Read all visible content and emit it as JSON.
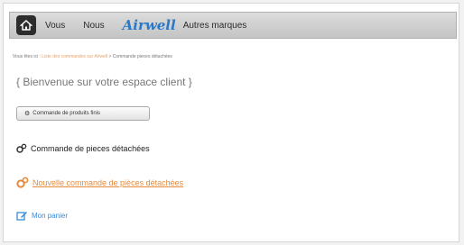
{
  "nav": {
    "items": [
      {
        "label": "Vous"
      },
      {
        "label": "Nous"
      }
    ],
    "brand": "Airwell",
    "other_brands": "Autres marques"
  },
  "breadcrumb": {
    "start": "Vous êtes ici :",
    "link": "Liste des commandes sur Airwell",
    "current": "> Commande pieces détachées"
  },
  "welcome": "{ Bienvenue sur votre espace client }",
  "order_button": {
    "label": "Commande de produits finis"
  },
  "section": {
    "title": "Commande de pieces détachées"
  },
  "links": {
    "orange": "Nouvelle commande de pièces détachées",
    "blue": "Mon panier"
  },
  "colors": {
    "brand": "#2a78c8",
    "link_orange": "#e58a3a",
    "link_blue": "#3a8ad6"
  },
  "icons": [
    "home-icon",
    "gears-icon",
    "edit-icon"
  ]
}
